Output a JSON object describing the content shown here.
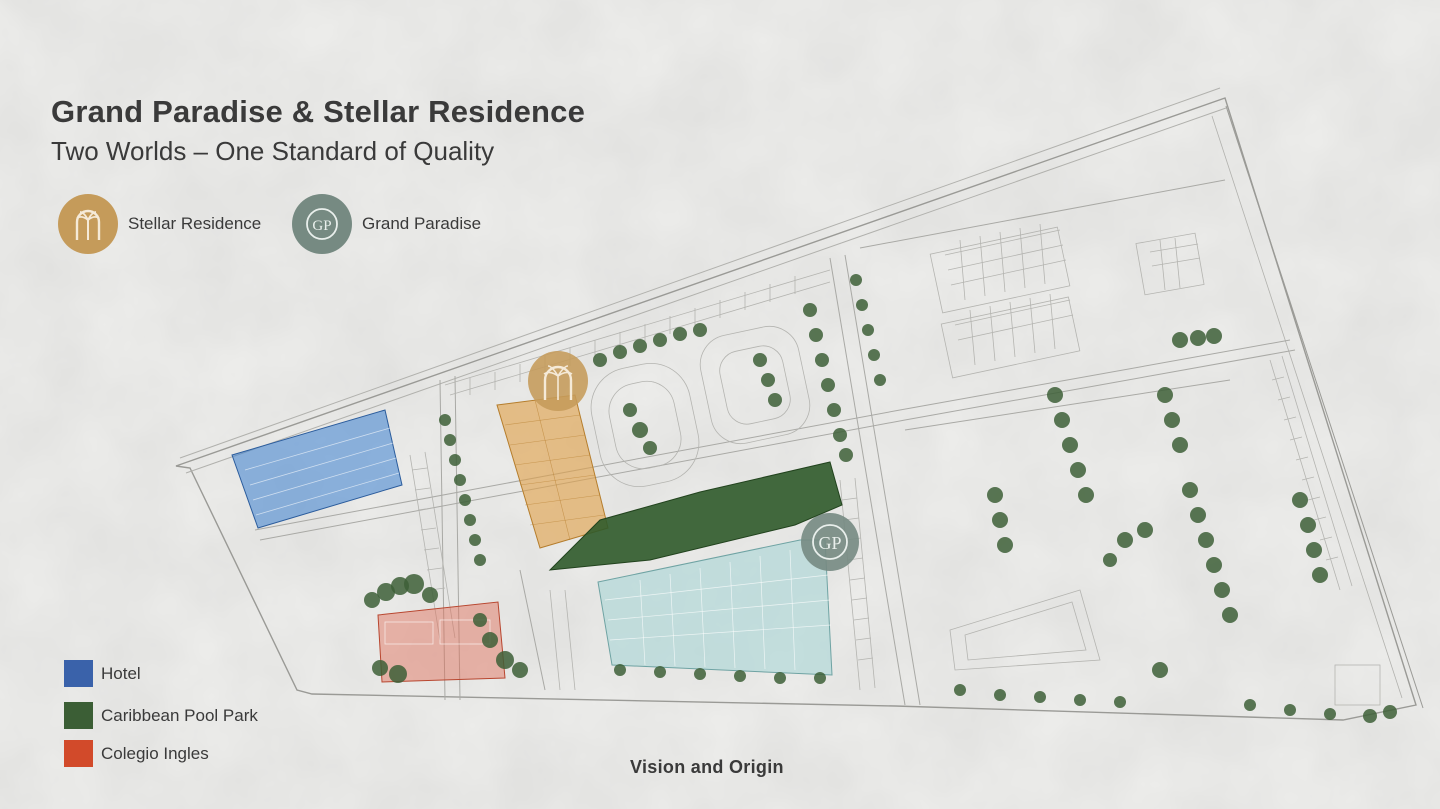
{
  "header": {
    "title": "Grand Paradise & Stellar Residence",
    "subtitle": "Two Worlds – One Standard of Quality"
  },
  "brands": [
    {
      "label": "Stellar Residence",
      "color": "#c59b5a",
      "icon": "palm-arch-icon"
    },
    {
      "label": "Grand Paradise",
      "color": "#768a82",
      "icon": "gp-monogram-icon",
      "monogram": "GP"
    }
  ],
  "legend": [
    {
      "label": "Hotel",
      "color": "#3a62aa"
    },
    {
      "label": "Caribbean Pool Park",
      "color": "#3b5e35"
    },
    {
      "label": "Colegio Ingles",
      "color": "#d24a2a"
    }
  ],
  "zones": {
    "hotel": "#3a7fd0",
    "pool_park": "#2f5a2a",
    "colegio": "#e06a55",
    "stellar_area": "#e0a24a",
    "grand_area": "#a9d6d6"
  },
  "footer": {
    "text": "Vision and Origin"
  }
}
